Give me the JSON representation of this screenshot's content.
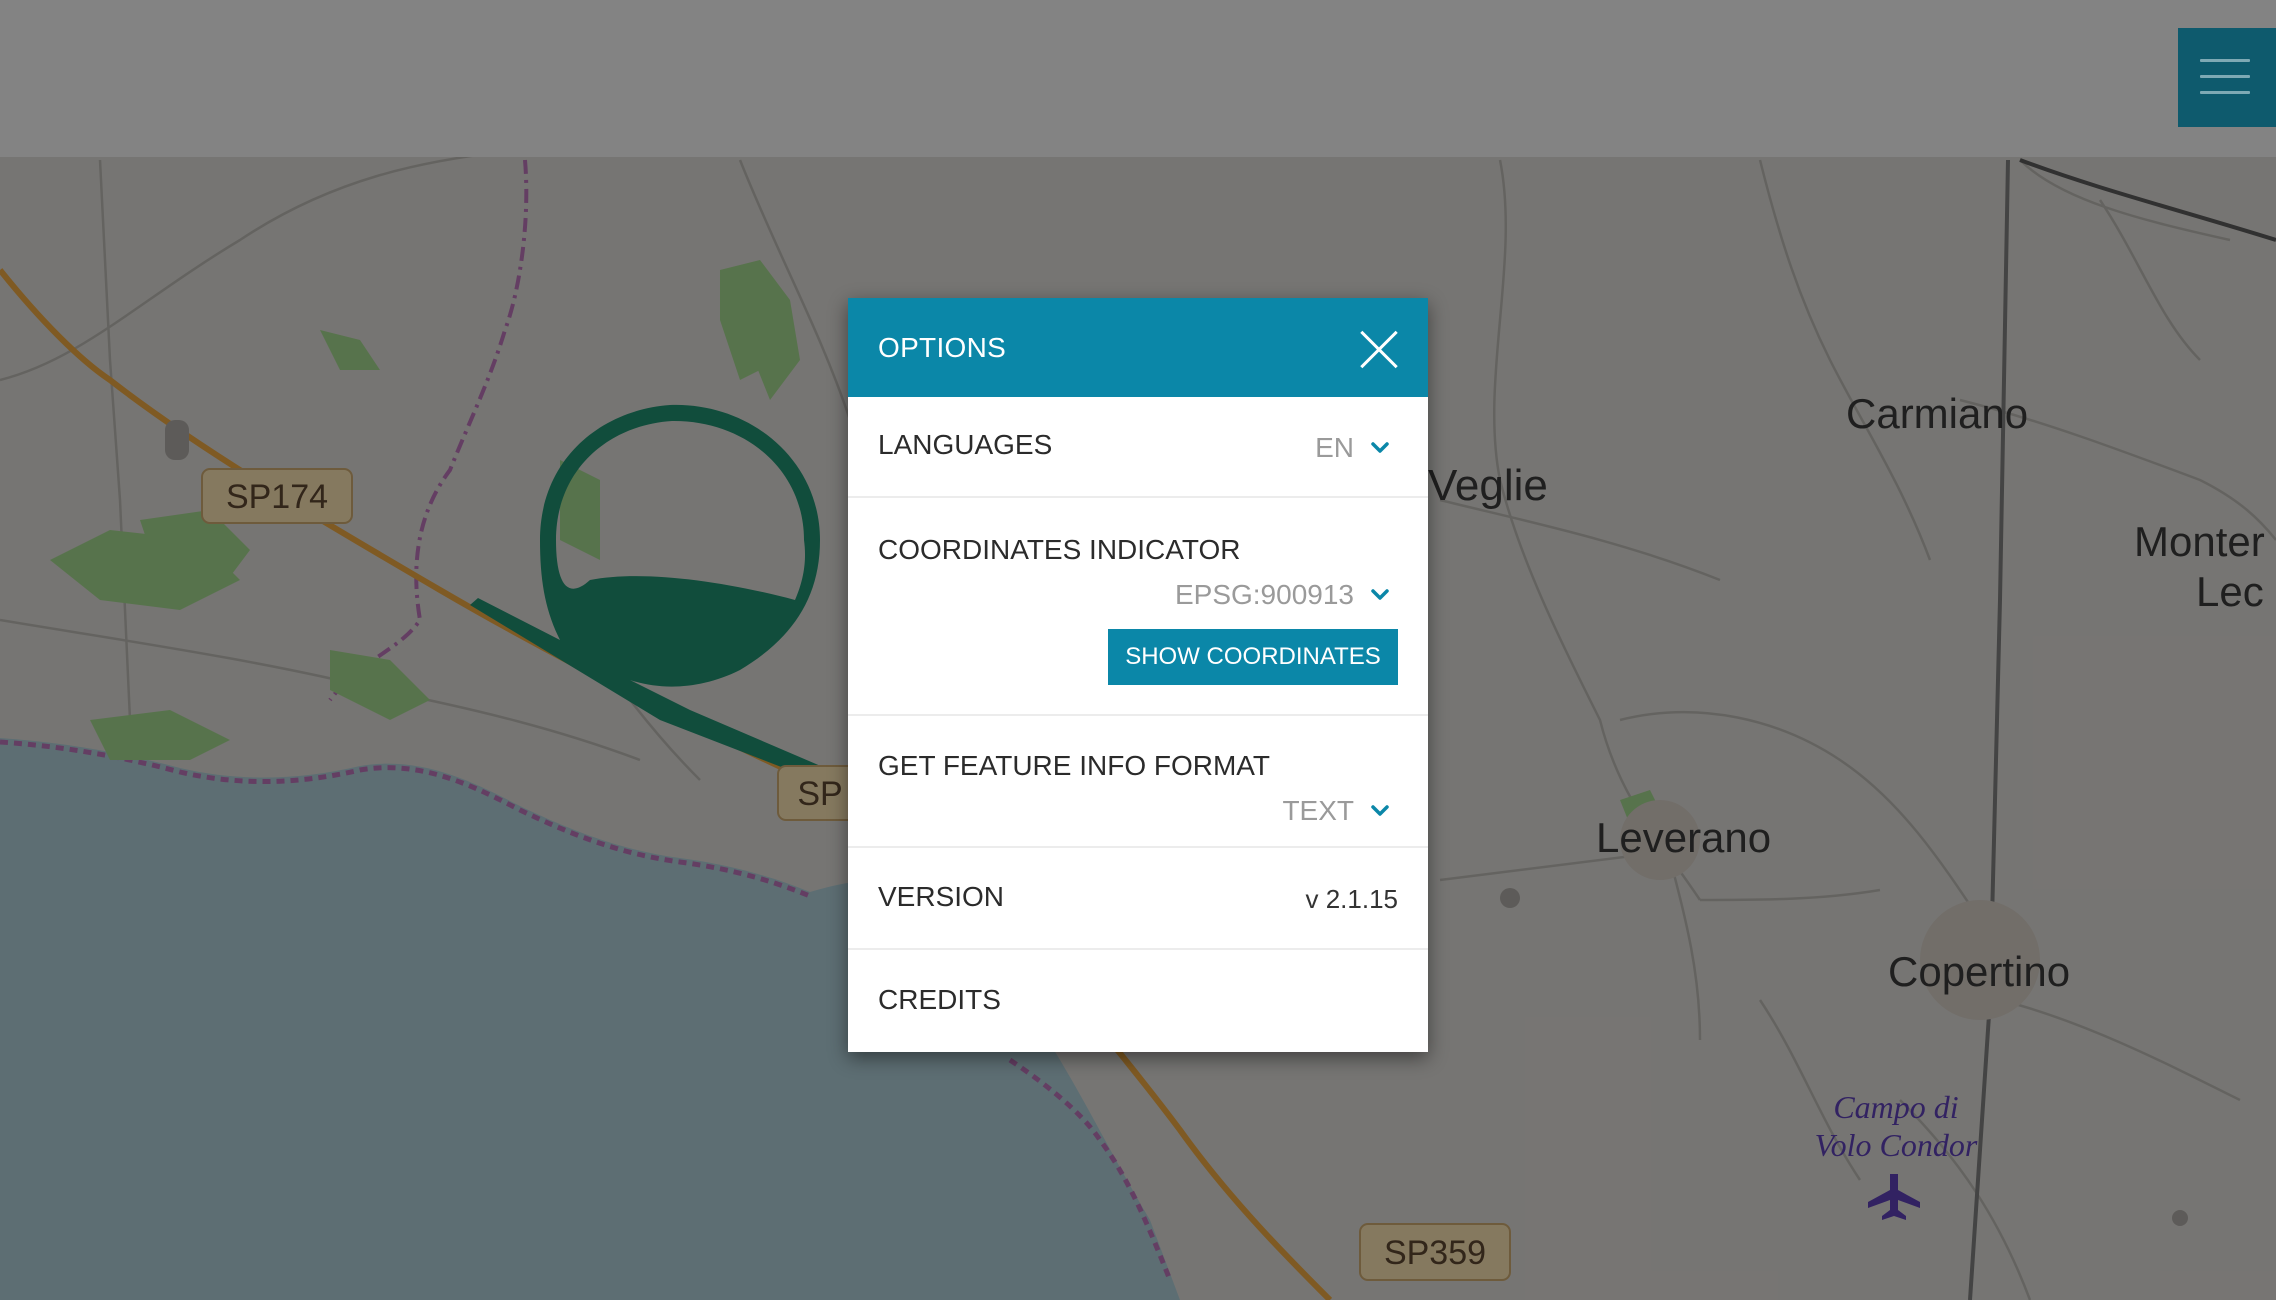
{
  "map": {
    "labels": {
      "veglie": "Veglie",
      "carmiano": "Carmiano",
      "monteroni_part1": "Monter",
      "monteroni_part2": "Lec",
      "leverano": "Leverano",
      "copertino": "Copertino",
      "campo_line1": "Campo di",
      "campo_line2": "Volo Condor",
      "sp174": "SP174",
      "sp_partial": "SP",
      "sp359": "SP359"
    }
  },
  "options_panel": {
    "title": "OPTIONS",
    "languages": {
      "label": "LANGUAGES",
      "value": "EN"
    },
    "coordinates": {
      "label": "COORDINATES INDICATOR",
      "value": "EPSG:900913",
      "button_label": "SHOW COORDINATES"
    },
    "feature_info": {
      "label": "GET FEATURE INFO FORMAT",
      "value": "TEXT"
    },
    "version": {
      "label": "VERSION",
      "value": "v 2.1.15"
    },
    "credits": {
      "label": "CREDITS"
    }
  },
  "colors": {
    "accent": "#0b87a8",
    "menu_button": "#0e5a6d",
    "sea": "#5f7371",
    "land": "#8e8e8c",
    "green_area": "#1f8c6e"
  },
  "icons": {
    "menu": "hamburger-icon",
    "close": "close-icon",
    "dropdown": "chevron-down-icon",
    "airport": "airplane-icon"
  }
}
